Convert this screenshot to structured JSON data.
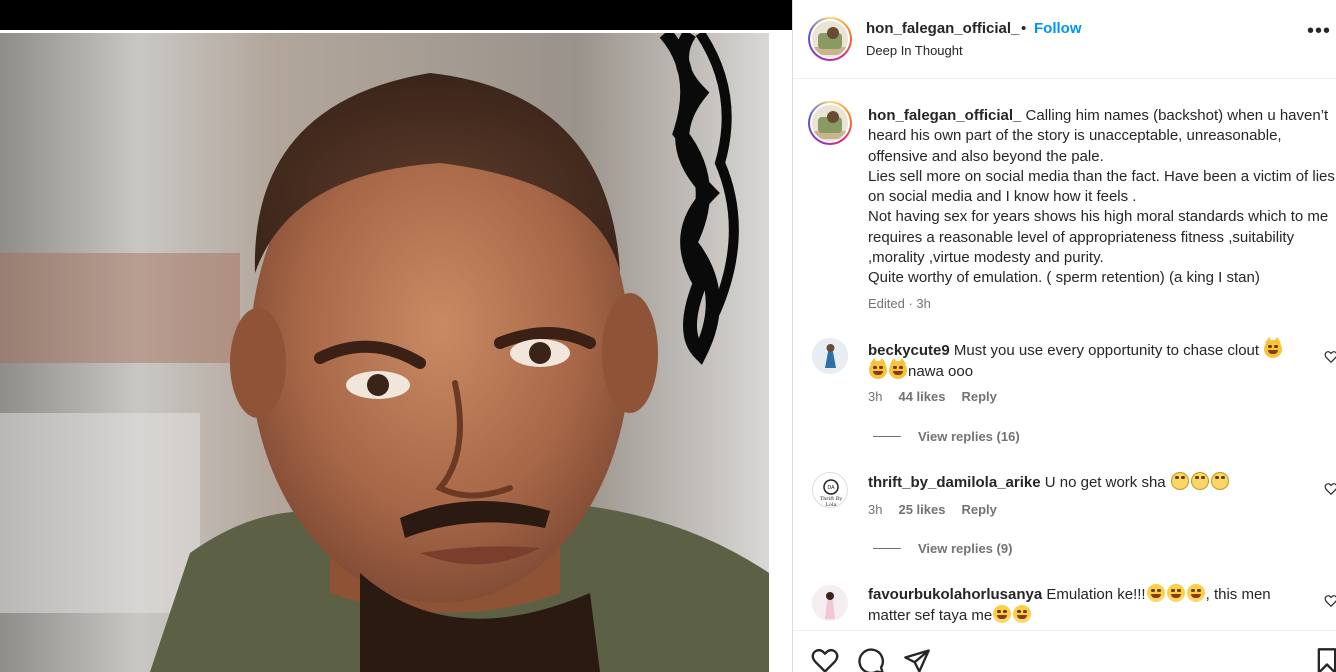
{
  "post": {
    "username": "hon_falegan_official_",
    "separator": "•",
    "follow_label": "Follow",
    "subtitle": "Deep In Thought",
    "more_label": "•••"
  },
  "caption": {
    "username": "hon_falegan_official_",
    "text_line1": " Calling him names (backshot) when u haven’t heard his own part of the story is unacceptable, unreasonable, offensive and also beyond the pale.",
    "text_line2": "Lies sell more on social media than the fact. Have been a victim of lies on social media and I know how it feels .",
    "text_line3": "Not having sex for years shows his high moral standards which to me requires a reasonable level of appropriateness fitness ,suitability ,morality ,virtue modesty and purity.",
    "text_line4": "Quite worthy of emulation. ( sperm retention) (a king I stan)",
    "meta": "Edited · 3h"
  },
  "comments": [
    {
      "username": "beckycute9",
      "text_a": " Must you use every opportunity to chase clout ",
      "text_b": "nawa ooo",
      "time": "3h",
      "likes": "44 likes",
      "reply_label": "Reply",
      "view_replies": "View replies (16)",
      "emoji": "laughing-cat-emoji"
    },
    {
      "username": "thrift_by_damilola_arike",
      "text_a": " U no get work sha ",
      "time": "3h",
      "likes": "25 likes",
      "reply_label": "Reply",
      "view_replies": "View replies (9)",
      "emoji": "eye-roll-emoji"
    },
    {
      "username": "favourbukolahorlusanya",
      "text_a": " Emulation ke!!!",
      "text_b": ", this men matter sef taya me",
      "emoji": "grinning-laugh-emoji"
    }
  ],
  "icons": {
    "like": "heart-icon",
    "comment": "comment-icon",
    "share": "send-icon",
    "save": "bookmark-icon"
  },
  "colors": {
    "link_blue": "#0095f6",
    "meta_gray": "#737373",
    "text": "#262626"
  }
}
